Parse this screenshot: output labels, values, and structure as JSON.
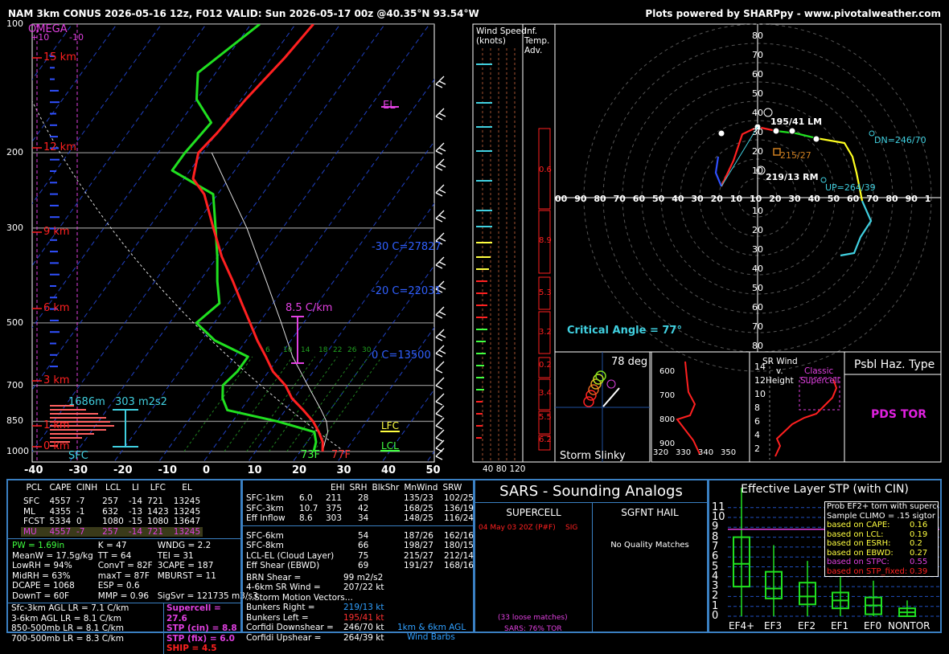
{
  "header": {
    "left": "NAM 3km CONUS 2026-05-16 12z, F012  VALID: Sun 2026-05-17 00z @40.35°N 93.54°W",
    "right": "Plots powered by SHARPpy - www.pivotalweather.com"
  },
  "skewt": {
    "omega_title": "OMEGA",
    "omega_plus": "+10",
    "omega_minus": "-10",
    "pressure_levels": [
      {
        "p": 100,
        "label": "100"
      },
      {
        "p": 200,
        "label": "200"
      },
      {
        "p": 300,
        "label": "300"
      },
      {
        "p": 500,
        "label": "500"
      },
      {
        "p": 700,
        "label": "700"
      },
      {
        "p": 850,
        "label": "850"
      },
      {
        "p": 1000,
        "label": "1000"
      }
    ],
    "height_labels": [
      "15 km",
      "12 km",
      "9 km",
      "6 km",
      "3 km",
      "1 km",
      "0 km"
    ],
    "temp_ticks": [
      "-40",
      "-30",
      "-20",
      "-10",
      "0",
      "10",
      "20",
      "30",
      "40",
      "50"
    ],
    "annotations": {
      "el": "EL",
      "lfc": "LFC",
      "lcl": "LCL",
      "lapse": "8.5 C/km",
      "c30": "-30 C=27827",
      "c20": "-20 C=22031",
      "c0": "0 C=13500",
      "sfc_label": "SFC",
      "sfc_t": "77F",
      "sfc_td": "73F",
      "eff_depth": "1686m",
      "eff_srh": "303 m2s2",
      "mix_ratio": [
        "6",
        "10",
        "14",
        "18",
        "22",
        "26",
        "30"
      ]
    },
    "temperature_profile": [
      [
        1000,
        25
      ],
      [
        950,
        23.5
      ],
      [
        900,
        21
      ],
      [
        850,
        18
      ],
      [
        800,
        14
      ],
      [
        750,
        9.5
      ],
      [
        700,
        6
      ],
      [
        650,
        1
      ],
      [
        600,
        -3
      ],
      [
        550,
        -7.5
      ],
      [
        500,
        -12
      ],
      [
        450,
        -17
      ],
      [
        400,
        -22.5
      ],
      [
        350,
        -29
      ],
      [
        300,
        -35.5
      ],
      [
        250,
        -43
      ],
      [
        230,
        -48
      ],
      [
        200,
        -51
      ],
      [
        180,
        -50
      ],
      [
        150,
        -49
      ],
      [
        120,
        -47
      ],
      [
        100,
        -46
      ]
    ],
    "dewpoint_profile": [
      [
        1000,
        23
      ],
      [
        950,
        22
      ],
      [
        900,
        20
      ],
      [
        850,
        10
      ],
      [
        800,
        -3
      ],
      [
        750,
        -6
      ],
      [
        700,
        -8
      ],
      [
        650,
        -7
      ],
      [
        600,
        -7
      ],
      [
        550,
        -17
      ],
      [
        500,
        -24
      ],
      [
        450,
        -22
      ],
      [
        400,
        -26
      ],
      [
        350,
        -30
      ],
      [
        300,
        -35
      ],
      [
        250,
        -41
      ],
      [
        220,
        -54
      ],
      [
        200,
        -54
      ],
      [
        170,
        -53
      ],
      [
        150,
        -60
      ],
      [
        130,
        -64
      ],
      [
        100,
        -58
      ]
    ],
    "parcel_profile": [
      [
        1000,
        25
      ],
      [
        950,
        24
      ],
      [
        900,
        23
      ],
      [
        850,
        21
      ],
      [
        800,
        18
      ],
      [
        700,
        11
      ],
      [
        600,
        3
      ],
      [
        500,
        -5
      ],
      [
        400,
        -15
      ],
      [
        300,
        -28
      ],
      [
        250,
        -37
      ],
      [
        200,
        -48
      ]
    ]
  },
  "wind_panel": {
    "title1": "Wind Speed",
    "title2": "(knots)",
    "adv1": "Inf.",
    "adv2": "Temp.",
    "adv3": "Adv.",
    "adv_values": [
      "0.6",
      "8.9",
      "5.3",
      "3.2",
      "0.2",
      "3.4",
      "5.5",
      "6.2"
    ],
    "bottom_ticks": [
      "40",
      "80",
      "120"
    ]
  },
  "hodograph": {
    "rings_up": [
      "80",
      "70",
      "60",
      "50",
      "40",
      "30",
      "20",
      "10"
    ],
    "rings_down": [
      "10",
      "20",
      "30",
      "40",
      "50",
      "60",
      "70",
      "80"
    ],
    "x_ticks": [
      "00",
      "90",
      "80",
      "70",
      "60",
      "50",
      "40",
      "30",
      "20",
      "10",
      "10",
      "20",
      "30",
      "40",
      "50",
      "60",
      "70",
      "80",
      "90",
      "1"
    ],
    "lm": "195/41 LM",
    "rm": "219/13 RM",
    "mean": "215/27",
    "dn": "DN=246/70",
    "up": "UP=264/39",
    "critical_angle": "Critical Angle = 77°",
    "ring_points": [
      "6",
      "4",
      "3",
      "2",
      "1"
    ]
  },
  "inset_slinky": {
    "deg": "78 deg",
    "label": "Storm Slinky"
  },
  "inset_theta": {
    "y_ticks": [
      "600",
      "700",
      "800",
      "900"
    ],
    "x_ticks": [
      "320",
      "330",
      "340",
      "350"
    ]
  },
  "inset_srwind": {
    "title1": "SR Wind",
    "title2": "v.",
    "title3": "Height",
    "y_ticks": [
      "14",
      "12",
      "10",
      "8",
      "6",
      "4",
      "2"
    ],
    "classic1": "Classic",
    "classic2": "Supercell"
  },
  "hazard": {
    "title": "Psbl Haz. Type",
    "value": "PDS TOR"
  },
  "parcel_table": {
    "headers": [
      "PCL",
      "CAPE",
      "CINH",
      "LCL",
      "LI",
      "LFC",
      "EL"
    ],
    "rows": [
      [
        "SFC",
        "4557",
        "-7",
        "257",
        "-14",
        "721",
        "13245"
      ],
      [
        "ML",
        "4355",
        "-1",
        "632",
        "-13",
        "1423",
        "13245"
      ],
      [
        "FCST",
        "5334",
        "0",
        "1080",
        "-15",
        "1080",
        "13647"
      ],
      [
        "MU",
        "4557",
        "-7",
        "257",
        "-14",
        "721",
        "13245"
      ]
    ]
  },
  "thermo_params": [
    [
      "PW = 1.69in",
      "K = 47",
      "WNDG = 2.2"
    ],
    [
      "MeanW = 17.5g/kg",
      "TT = 64",
      "TEI = 31"
    ],
    [
      "LowRH = 94%",
      "ConvT = 82F",
      "3CAPE = 187"
    ],
    [
      "MidRH = 63%",
      "maxT = 87F",
      "MBURST = 11"
    ],
    [
      "DCAPE = 1068",
      "ESP = 0.6",
      ""
    ],
    [
      "DownT = 60F",
      "MMP = 0.96",
      "SigSvr = 121735 m3/s3"
    ]
  ],
  "lapse_rates": [
    "Sfc-3km AGL LR = 7.1 C/km",
    "3-6km AGL LR = 8.1 C/km",
    "850-500mb LR = 8.1 C/km",
    "700-500mb LR = 8.3 C/km"
  ],
  "composites": [
    {
      "label": "Supercell = 27.6",
      "color": "#e040e0"
    },
    {
      "label": "STP (cin) = 8.8",
      "color": "#e040e0"
    },
    {
      "label": "STP (fix) = 6.0",
      "color": "#e040e0"
    },
    {
      "label": "SHIP = 4.5",
      "color": "#ff2020"
    }
  ],
  "kinematic_table": {
    "headers": [
      "",
      "EHI",
      "SRH",
      "BlkShr",
      "MnWind",
      "SRW"
    ],
    "rows": [
      [
        "SFC-1km",
        "6.0",
        "211",
        "28",
        "135/23",
        "102/25"
      ],
      [
        "SFC-3km",
        "10.7",
        "375",
        "42",
        "168/25",
        "136/19"
      ],
      [
        "Eff Inflow",
        "8.6",
        "303",
        "34",
        "148/25",
        "116/24"
      ],
      [
        "",
        "",
        "",
        "",
        "",
        ""
      ],
      [
        "SFC-6km",
        "",
        "",
        "54",
        "187/26",
        "162/16"
      ],
      [
        "SFC-8km",
        "",
        "",
        "66",
        "198/27",
        "180/15"
      ],
      [
        "LCL-EL (Cloud Layer)",
        "",
        "",
        "75",
        "215/27",
        "212/14"
      ],
      [
        "Eff Shear (EBWD)",
        "",
        "",
        "69",
        "191/27",
        "168/16"
      ]
    ],
    "brn_label": "BRN Shear =",
    "brn_value": "99 m2/s2",
    "srw_label": "4-6km SR Wind =",
    "srw_value": "207/22 kt",
    "storm_title": "...Storm Motion Vectors...",
    "storm_vectors": [
      {
        "label": "Bunkers Right =",
        "value": "219/13 kt",
        "color": "#30a0ff"
      },
      {
        "label": "Bunkers Left =",
        "value": "195/41 kt",
        "color": "#ff3030"
      },
      {
        "label": "Corfidi Downshear =",
        "value": "246/70 kt",
        "color": "#ffffff"
      },
      {
        "label": "Corfidi Upshear =",
        "value": "264/39 kt",
        "color": "#ffffff"
      }
    ],
    "barb_note1": "1km & 6km AGL",
    "barb_note2": "Wind Barbs"
  },
  "sars": {
    "title": "SARS - Sounding Analogs",
    "supercell": "SUPERCELL",
    "hail": "SGFNT HAIL",
    "match": "04 May 03 20Z (P#F)",
    "match_tag": "SIG",
    "no_match": "No Quality Matches",
    "loose": "(33 loose matches)",
    "pct": "SARS: 76% TOR"
  },
  "stp_panel": {
    "title": "Effective Layer STP (with CIN)",
    "y_ticks": [
      "11",
      "10",
      "9",
      "8",
      "7",
      "6",
      "5",
      "4",
      "3",
      "2",
      "1",
      "0"
    ],
    "categories": [
      "EF4+",
      "EF3",
      "EF2",
      "EF1",
      "EF0",
      "NONTOR"
    ],
    "prob_title": "Prob EF2+ torn with supercell",
    "clim": "Sample CLIMO = .15 sigtor",
    "probs": [
      {
        "label": "based on CAPE:",
        "value": "0.16",
        "color": "#ffff40"
      },
      {
        "label": "based on LCL:",
        "value": "0.19",
        "color": "#ffff40"
      },
      {
        "label": "based on ESRH:",
        "value": "0.2",
        "color": "#ffff40"
      },
      {
        "label": "based on EBWD:",
        "value": "0.27",
        "color": "#ffff40"
      },
      {
        "label": "based on STPC:",
        "value": "0.55",
        "color": "#e040e0"
      },
      {
        "label": "based on STP_fixed:",
        "value": "0.39",
        "color": "#ff2020"
      }
    ]
  },
  "chart_data": [
    {
      "type": "line",
      "title": "Skew-T Log-P",
      "xlabel": "",
      "ylabel": "",
      "ylim": [
        1000,
        100
      ],
      "xlim": [
        -40,
        50
      ],
      "series": [
        {
          "name": "Temperature",
          "values": [
            [
              1000,
              25
            ],
            [
              850,
              18
            ],
            [
              700,
              6
            ],
            [
              500,
              -12
            ],
            [
              300,
              -35.5
            ],
            [
              200,
              -51
            ],
            [
              100,
              -46
            ]
          ]
        },
        {
          "name": "Dewpoint",
          "values": [
            [
              1000,
              23
            ],
            [
              850,
              10
            ],
            [
              700,
              -8
            ],
            [
              500,
              -24
            ],
            [
              300,
              -35
            ],
            [
              200,
              -54
            ],
            [
              100,
              -58
            ]
          ]
        }
      ]
    },
    {
      "type": "scatter",
      "title": "Hodograph",
      "points": [
        {
          "label": "195/41 LM"
        },
        {
          "label": "219/13 RM"
        },
        {
          "label": "215/27"
        },
        {
          "label": "DN=246/70"
        },
        {
          "label": "UP=264/39"
        }
      ]
    },
    {
      "type": "bar",
      "title": "Effective Layer STP (with CIN)",
      "categories": [
        "EF4+",
        "EF3",
        "EF2",
        "EF1",
        "EF0",
        "NONTOR"
      ],
      "series": [
        {
          "name": "median",
          "values": [
            5.3,
            2.8,
            2.0,
            1.6,
            1.1,
            0.4
          ]
        },
        {
          "name": "q25",
          "values": [
            3.0,
            1.8,
            1.2,
            0.8,
            0.2,
            0.0
          ]
        },
        {
          "name": "q75",
          "values": [
            8.0,
            4.5,
            3.4,
            2.4,
            1.9,
            0.8
          ]
        }
      ],
      "ylim": [
        0,
        11
      ]
    }
  ]
}
